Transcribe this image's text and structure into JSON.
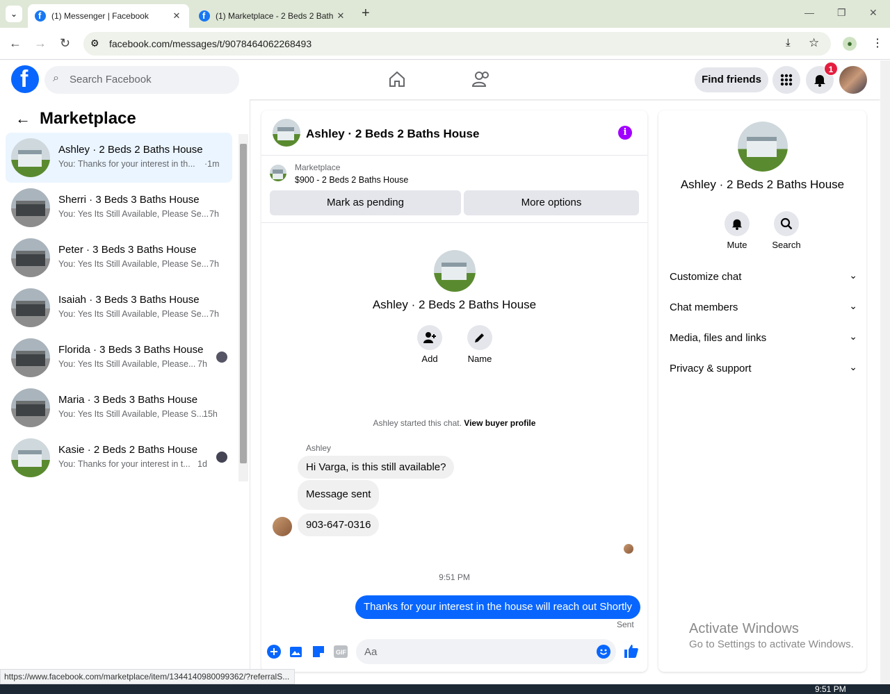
{
  "browser": {
    "tabs": [
      {
        "title": "(1) Messenger | Facebook",
        "close": "✕"
      },
      {
        "title": "(1) Marketplace - 2 Beds 2 Bath",
        "close": "✕"
      }
    ],
    "new_tab": "+",
    "url": "facebook.com/messages/t/9078464062268493",
    "window_controls": {
      "minimize": "—",
      "restore": "❐",
      "close": "✕"
    },
    "status_url": "https://www.facebook.com/marketplace/item/1344140980099362/?referralS..."
  },
  "fb_header": {
    "logo_letter": "f",
    "search_placeholder": "Search Facebook",
    "find_friends": "Find friends",
    "notification_count": "1"
  },
  "left": {
    "title": "Marketplace",
    "conversations": [
      {
        "name": "Ashley · 2 Beds 2 Baths House",
        "snippet": "You: Thanks for your interest in th...",
        "time": "·1m",
        "selected": true
      },
      {
        "name": "Sherri · 3 Beds 3 Baths House",
        "snippet": "You: Yes Its Still Available, Please Se...",
        "time": "7h"
      },
      {
        "name": "Peter · 3 Beds 3 Baths House",
        "snippet": "You: Yes Its Still Available, Please Se...",
        "time": "7h"
      },
      {
        "name": "Isaiah · 3 Beds 3 Baths House",
        "snippet": "You: Yes Its Still Available, Please Se...",
        "time": "7h"
      },
      {
        "name": "Florida · 3 Beds 3 Baths House",
        "snippet": "You: Yes Its Still Available, Please...",
        "time": "7h"
      },
      {
        "name": "Maria · 3 Beds 3 Baths House",
        "snippet": "You: Yes Its Still Available, Please S...",
        "time": "15h"
      },
      {
        "name": "Kasie · 2 Beds 2 Baths House",
        "snippet": "You: Thanks for your interest in t...",
        "time": "1d"
      }
    ]
  },
  "chat": {
    "title": "Ashley · 2 Beds 2 Baths House",
    "marketplace_label": "Marketplace",
    "listing": "$900 - 2 Beds 2 Baths House",
    "mark_pending": "Mark as pending",
    "more_options": "More options",
    "center_title": "Ashley · 2 Beds 2 Baths House",
    "add_label": "Add",
    "name_label": "Name",
    "started_text": "Ashley started this chat.",
    "view_profile": "View buyer profile",
    "sender": "Ashley",
    "messages": [
      {
        "text": "Hi Varga, is this still available?"
      },
      {
        "text": "Message sent"
      },
      {
        "text": "903-647-0316"
      }
    ],
    "timestamp": "9:51 PM",
    "my_message": "Thanks for your interest in the house will reach out Shortly",
    "sent_label": "Sent",
    "composer_placeholder": "Aa"
  },
  "right": {
    "name": "Ashley · 2 Beds 2 Baths House",
    "mute": "Mute",
    "search": "Search",
    "sections": [
      "Customize chat",
      "Chat members",
      "Media, files and links",
      "Privacy & support"
    ]
  },
  "watermark": {
    "line1": "Activate Windows",
    "line2": "Go to Settings to activate Windows."
  },
  "taskbar": {
    "clock": "9:51 PM"
  },
  "colors": {
    "fb_blue": "#0866ff",
    "selected_row": "#ebf5ff",
    "info_purple": "#a100ff"
  }
}
